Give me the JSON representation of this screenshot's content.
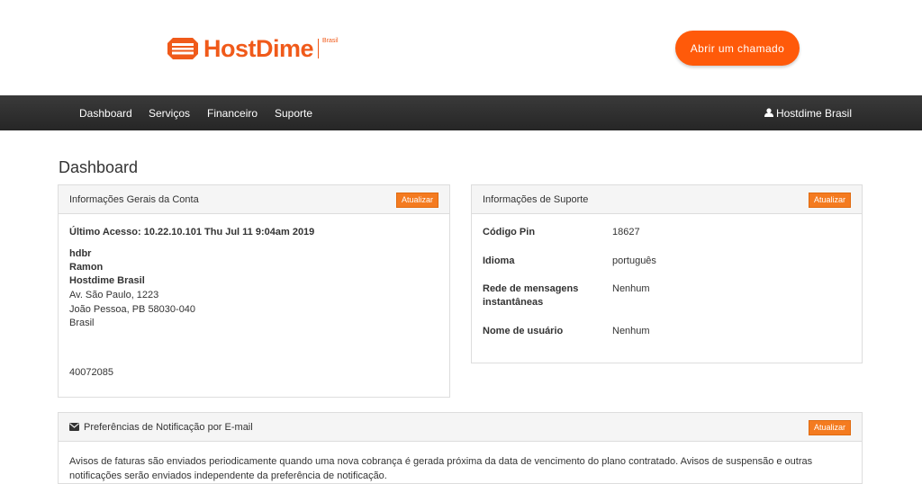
{
  "brand": {
    "name": "HostDime",
    "sub": "Brasil",
    "orange": "#f05a1a"
  },
  "header": {
    "cta_label": "Abrir um chamado"
  },
  "nav": {
    "items": [
      {
        "label": "Dashboard"
      },
      {
        "label": "Serviços"
      },
      {
        "label": "Financeiro"
      },
      {
        "label": "Suporte"
      }
    ],
    "user_label": "Hostdime Brasil",
    "user_icon": "user-icon"
  },
  "page": {
    "title": "Dashboard"
  },
  "account_panel": {
    "title": "Informações Gerais da Conta",
    "update_label": "Atualizar",
    "last_access": "Último Acesso: 10.22.10.101 Thu Jul 11 9:04am 2019",
    "username": "hdbr",
    "name": "Ramon",
    "company": "Hostdime Brasil",
    "address1": "Av. São Paulo, 1223",
    "address2": "João Pessoa, PB 58030-040",
    "country": "Brasil",
    "phone": "40072085"
  },
  "support_panel": {
    "title": "Informações de Suporte",
    "update_label": "Atualizar",
    "rows": [
      {
        "label": "Código Pin",
        "value": "18627"
      },
      {
        "label": "Idioma",
        "value": "português"
      },
      {
        "label": "Rede de mensagens instantâneas",
        "value": "Nenhum"
      },
      {
        "label": "Nome de usuário",
        "value": "Nenhum"
      }
    ]
  },
  "notif_panel": {
    "title": "Preferências de Notificação por E-mail",
    "icon": "envelope-icon",
    "update_label": "Atualizar",
    "text": "Avisos de faturas são enviados periodicamente quando uma nova cobrança é gerada próxima da data de vencimento do plano contratado. Avisos de suspensão e outras notificações serão enviados independente da preferência de notificação."
  }
}
